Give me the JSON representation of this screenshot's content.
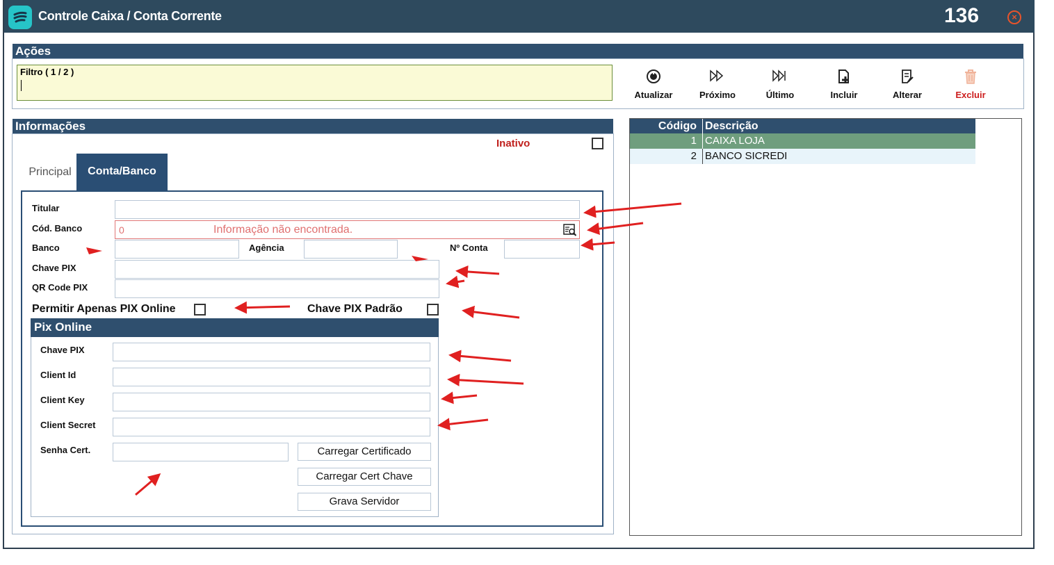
{
  "window": {
    "title": "Controle Caixa / Conta Corrente",
    "id": "136"
  },
  "acoes": {
    "header": "Ações",
    "filter_label": "Filtro ( 1 / 2 )",
    "toolbar": {
      "atualizar": "Atualizar",
      "proximo": "Próximo",
      "ultimo": "Último",
      "incluir": "Incluir",
      "alterar": "Alterar",
      "excluir": "Excluir"
    }
  },
  "informacoes": {
    "header": "Informações",
    "inativo_label": "Inativo",
    "tabs": {
      "principal": "Principal",
      "conta_banco": "Conta/Banco"
    },
    "fields": {
      "titular": "Titular",
      "cod_banco": "Cód. Banco",
      "cod_banco_value": "0",
      "cod_banco_message": "Informação não encontrada.",
      "banco": "Banco",
      "agencia": "Agência",
      "n_conta": "Nº Conta",
      "chave_pix": "Chave PIX",
      "qr_code_pix": "QR Code PIX",
      "permitir_pix_online": "Permitir Apenas PIX Online",
      "chave_pix_padrao": "Chave PIX Padrão"
    },
    "pix_online": {
      "header": "Pix Online",
      "chave_pix": "Chave PIX",
      "client_id": "Client Id",
      "client_key": "Client Key",
      "client_secret": "Client Secret",
      "senha_cert": "Senha Cert.",
      "btn_carregar_certificado": "Carregar Certificado",
      "btn_carregar_cert_chave": "Carregar Cert Chave",
      "btn_grava_servidor": "Grava Servidor"
    }
  },
  "grid": {
    "columns": {
      "codigo": "Código",
      "descricao": "Descrição"
    },
    "rows": [
      {
        "codigo": "1",
        "descricao": "CAIXA LOJA"
      },
      {
        "codigo": "2",
        "descricao": "BANCO SICREDI"
      }
    ]
  },
  "colors": {
    "titlebar": "#2e4a5e",
    "header": "#2f4f6e",
    "tab_active": "#2a4e74",
    "error": "#e07070",
    "selected_row": "#6f9e7e",
    "annotation_arrow": "#e02020"
  }
}
